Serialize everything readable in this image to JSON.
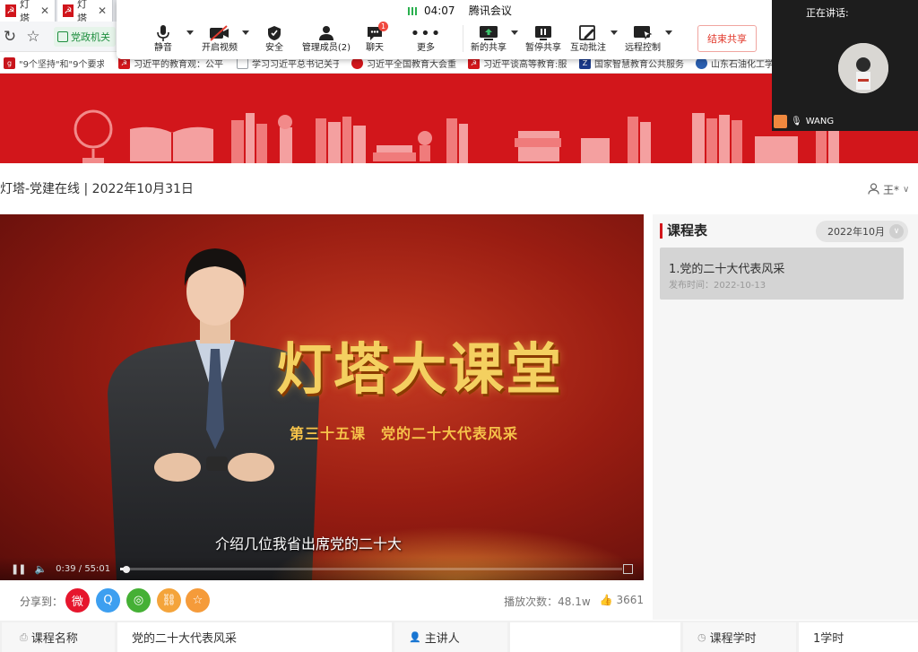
{
  "browser": {
    "tabs": [
      {
        "label": "灯塔",
        "icon": "party-flag-icon"
      },
      {
        "label": "灯塔",
        "icon": "party-flag-icon"
      }
    ],
    "toolbar": {
      "extension_label": "党政机关"
    },
    "bookmarks": [
      {
        "label": "\"9个坚持\"和\"9个要求",
        "color": "#c8141b"
      },
      {
        "label": "习近平的教育观：公平",
        "color": "#d2161b"
      },
      {
        "label": "学习习近平总书记关于",
        "color": "#9aa0a6"
      },
      {
        "label": "习近平全国教育大会重",
        "color": "#d2161b"
      },
      {
        "label": "习近平谈高等教育:服",
        "color": "#d2161b"
      },
      {
        "label": "国家智慧教育公共服务",
        "color": "#1a3a8a"
      },
      {
        "label": "山东石油化工学",
        "color": "#2b5fb0"
      }
    ]
  },
  "meeting": {
    "time": "04:07",
    "app_name": "腾讯会议",
    "buttons": {
      "mute": "静音",
      "video": "开启视频",
      "security": "安全",
      "members": "管理成员(2)",
      "chat": "聊天",
      "chat_badge": "1",
      "more": "更多",
      "new_share": "新的共享",
      "pause_share": "暂停共享",
      "annotate": "互动批注",
      "remote": "远程控制",
      "end_share": "结束共享"
    },
    "speaker": {
      "title": "正在讲话:",
      "name": "WANG"
    }
  },
  "page": {
    "title": "灯塔-党建在线 | 2022年10月31日",
    "user": "王*"
  },
  "video": {
    "title": "灯塔大课堂",
    "subtitle": "第三十五课　党的二十大代表风采",
    "caption": "介绍几位我省出席党的二十大",
    "time": "0:39 / 55:01",
    "progress": 0.012
  },
  "share": {
    "label": "分享到：",
    "icons": [
      "weibo-icon",
      "qq-icon",
      "wechat-icon",
      "link-icon",
      "favorite-icon"
    ],
    "colors": [
      "#e6162d",
      "#3d9ff0",
      "#45b035",
      "#f4a43b",
      "#f59b3a"
    ],
    "views": "播放次数：48.1w",
    "likes": "3661"
  },
  "schedule": {
    "title": "课程表",
    "month": "2022年10月",
    "items": [
      {
        "title": "1.党的二十大代表风采",
        "date": "发布时间：2022-10-13"
      }
    ]
  },
  "info": {
    "name_label": "课程名称",
    "name_value": "党的二十大代表风采",
    "lecturer_label": "主讲人",
    "lecturer_value": "",
    "hours_label": "课程学时",
    "hours_value": "1学时"
  }
}
